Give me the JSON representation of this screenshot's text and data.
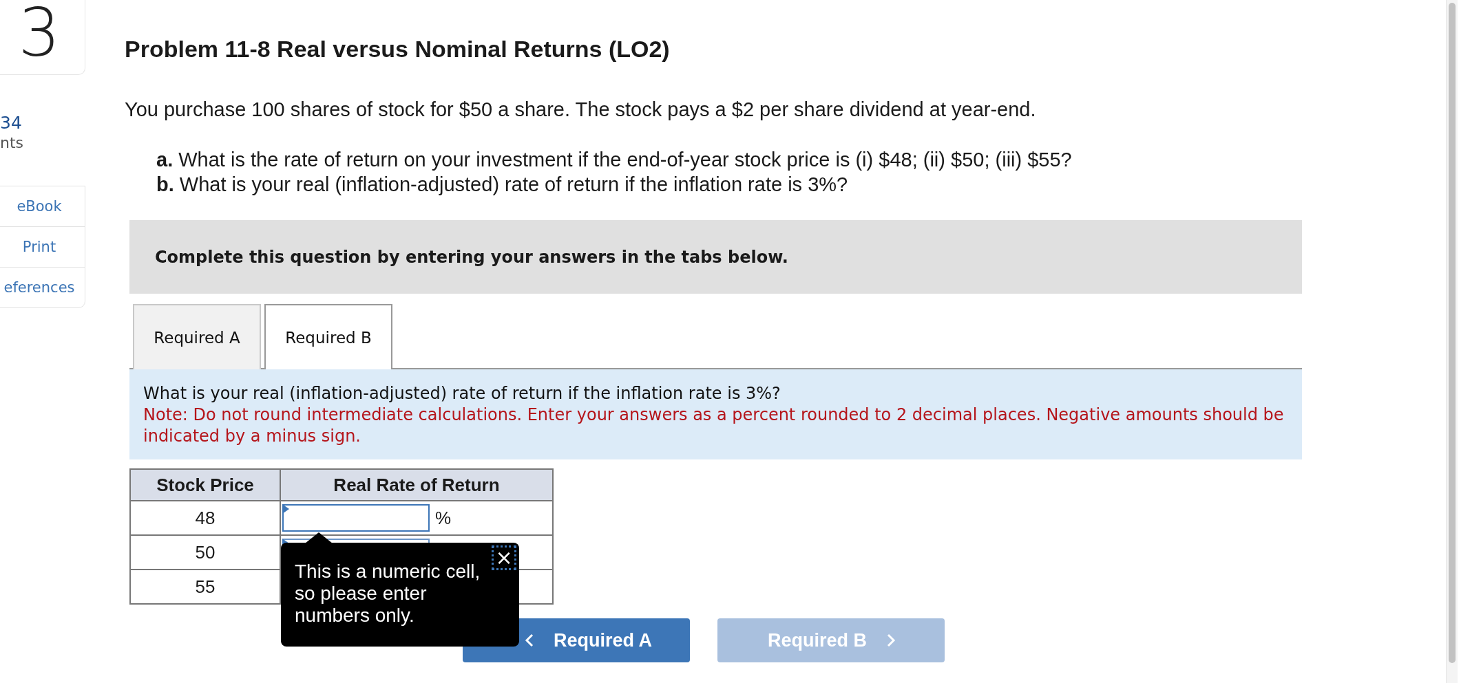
{
  "sidebar": {
    "question_number": "3",
    "score": "34",
    "score_label": "nts",
    "links": [
      {
        "label": "eBook"
      },
      {
        "label": "Print"
      },
      {
        "label": "eferences"
      }
    ]
  },
  "title": "Problem 11-8 Real versus Nominal Returns (LO2)",
  "intro": "You purchase 100 shares of stock for $50 a share. The stock pays a $2 per share dividend at year-end.",
  "parts": [
    {
      "letter": "a.",
      "text": "What is the rate of return on your investment if the end-of-year stock price is (i) $48; (ii) $50; (iii) $55?"
    },
    {
      "letter": "b.",
      "text": "What is your real (inflation-adjusted) rate of return if the inflation rate is 3%?"
    }
  ],
  "instruction": "Complete this question by entering your answers in the tabs below.",
  "tabs": [
    {
      "label": "Required A",
      "selected": false
    },
    {
      "label": "Required B",
      "selected": true
    }
  ],
  "panel": {
    "question": "What is your real (inflation-adjusted) rate of return if the inflation rate is 3%?",
    "note": "Note: Do not round intermediate calculations. Enter your answers as a percent rounded to 2 decimal places. Negative amounts should be indicated by a minus sign."
  },
  "table": {
    "columns": [
      "Stock Price",
      "Real Rate of Return"
    ],
    "rows": [
      {
        "price": "48",
        "unit": "%"
      },
      {
        "price": "50"
      },
      {
        "price": "55"
      }
    ]
  },
  "tooltip": {
    "close": "×",
    "text": "This is a numeric cell, so please enter numbers only."
  },
  "nav": [
    {
      "label": "Required A",
      "kind": "back",
      "disabled": false
    },
    {
      "label": "Required B",
      "kind": "forward",
      "disabled": true
    }
  ]
}
